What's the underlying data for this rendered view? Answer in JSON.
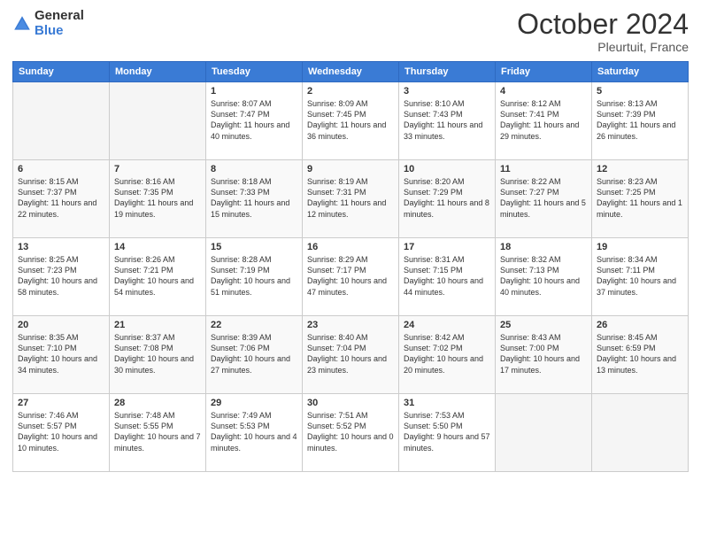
{
  "logo": {
    "general": "General",
    "blue": "Blue"
  },
  "title": "October 2024",
  "location": "Pleurtuit, France",
  "days_header": [
    "Sunday",
    "Monday",
    "Tuesday",
    "Wednesday",
    "Thursday",
    "Friday",
    "Saturday"
  ],
  "weeks": [
    [
      {
        "day": "",
        "empty": true
      },
      {
        "day": "",
        "empty": true
      },
      {
        "day": "1",
        "sunrise": "8:07 AM",
        "sunset": "7:47 PM",
        "daylight": "11 hours and 40 minutes."
      },
      {
        "day": "2",
        "sunrise": "8:09 AM",
        "sunset": "7:45 PM",
        "daylight": "11 hours and 36 minutes."
      },
      {
        "day": "3",
        "sunrise": "8:10 AM",
        "sunset": "7:43 PM",
        "daylight": "11 hours and 33 minutes."
      },
      {
        "day": "4",
        "sunrise": "8:12 AM",
        "sunset": "7:41 PM",
        "daylight": "11 hours and 29 minutes."
      },
      {
        "day": "5",
        "sunrise": "8:13 AM",
        "sunset": "7:39 PM",
        "daylight": "11 hours and 26 minutes."
      }
    ],
    [
      {
        "day": "6",
        "sunrise": "8:15 AM",
        "sunset": "7:37 PM",
        "daylight": "11 hours and 22 minutes."
      },
      {
        "day": "7",
        "sunrise": "8:16 AM",
        "sunset": "7:35 PM",
        "daylight": "11 hours and 19 minutes."
      },
      {
        "day": "8",
        "sunrise": "8:18 AM",
        "sunset": "7:33 PM",
        "daylight": "11 hours and 15 minutes."
      },
      {
        "day": "9",
        "sunrise": "8:19 AM",
        "sunset": "7:31 PM",
        "daylight": "11 hours and 12 minutes."
      },
      {
        "day": "10",
        "sunrise": "8:20 AM",
        "sunset": "7:29 PM",
        "daylight": "11 hours and 8 minutes."
      },
      {
        "day": "11",
        "sunrise": "8:22 AM",
        "sunset": "7:27 PM",
        "daylight": "11 hours and 5 minutes."
      },
      {
        "day": "12",
        "sunrise": "8:23 AM",
        "sunset": "7:25 PM",
        "daylight": "11 hours and 1 minute."
      }
    ],
    [
      {
        "day": "13",
        "sunrise": "8:25 AM",
        "sunset": "7:23 PM",
        "daylight": "10 hours and 58 minutes."
      },
      {
        "day": "14",
        "sunrise": "8:26 AM",
        "sunset": "7:21 PM",
        "daylight": "10 hours and 54 minutes."
      },
      {
        "day": "15",
        "sunrise": "8:28 AM",
        "sunset": "7:19 PM",
        "daylight": "10 hours and 51 minutes."
      },
      {
        "day": "16",
        "sunrise": "8:29 AM",
        "sunset": "7:17 PM",
        "daylight": "10 hours and 47 minutes."
      },
      {
        "day": "17",
        "sunrise": "8:31 AM",
        "sunset": "7:15 PM",
        "daylight": "10 hours and 44 minutes."
      },
      {
        "day": "18",
        "sunrise": "8:32 AM",
        "sunset": "7:13 PM",
        "daylight": "10 hours and 40 minutes."
      },
      {
        "day": "19",
        "sunrise": "8:34 AM",
        "sunset": "7:11 PM",
        "daylight": "10 hours and 37 minutes."
      }
    ],
    [
      {
        "day": "20",
        "sunrise": "8:35 AM",
        "sunset": "7:10 PM",
        "daylight": "10 hours and 34 minutes."
      },
      {
        "day": "21",
        "sunrise": "8:37 AM",
        "sunset": "7:08 PM",
        "daylight": "10 hours and 30 minutes."
      },
      {
        "day": "22",
        "sunrise": "8:39 AM",
        "sunset": "7:06 PM",
        "daylight": "10 hours and 27 minutes."
      },
      {
        "day": "23",
        "sunrise": "8:40 AM",
        "sunset": "7:04 PM",
        "daylight": "10 hours and 23 minutes."
      },
      {
        "day": "24",
        "sunrise": "8:42 AM",
        "sunset": "7:02 PM",
        "daylight": "10 hours and 20 minutes."
      },
      {
        "day": "25",
        "sunrise": "8:43 AM",
        "sunset": "7:00 PM",
        "daylight": "10 hours and 17 minutes."
      },
      {
        "day": "26",
        "sunrise": "8:45 AM",
        "sunset": "6:59 PM",
        "daylight": "10 hours and 13 minutes."
      }
    ],
    [
      {
        "day": "27",
        "sunrise": "7:46 AM",
        "sunset": "5:57 PM",
        "daylight": "10 hours and 10 minutes."
      },
      {
        "day": "28",
        "sunrise": "7:48 AM",
        "sunset": "5:55 PM",
        "daylight": "10 hours and 7 minutes."
      },
      {
        "day": "29",
        "sunrise": "7:49 AM",
        "sunset": "5:53 PM",
        "daylight": "10 hours and 4 minutes."
      },
      {
        "day": "30",
        "sunrise": "7:51 AM",
        "sunset": "5:52 PM",
        "daylight": "10 hours and 0 minutes."
      },
      {
        "day": "31",
        "sunrise": "7:53 AM",
        "sunset": "5:50 PM",
        "daylight": "9 hours and 57 minutes."
      },
      {
        "day": "",
        "empty": true
      },
      {
        "day": "",
        "empty": true
      }
    ]
  ]
}
